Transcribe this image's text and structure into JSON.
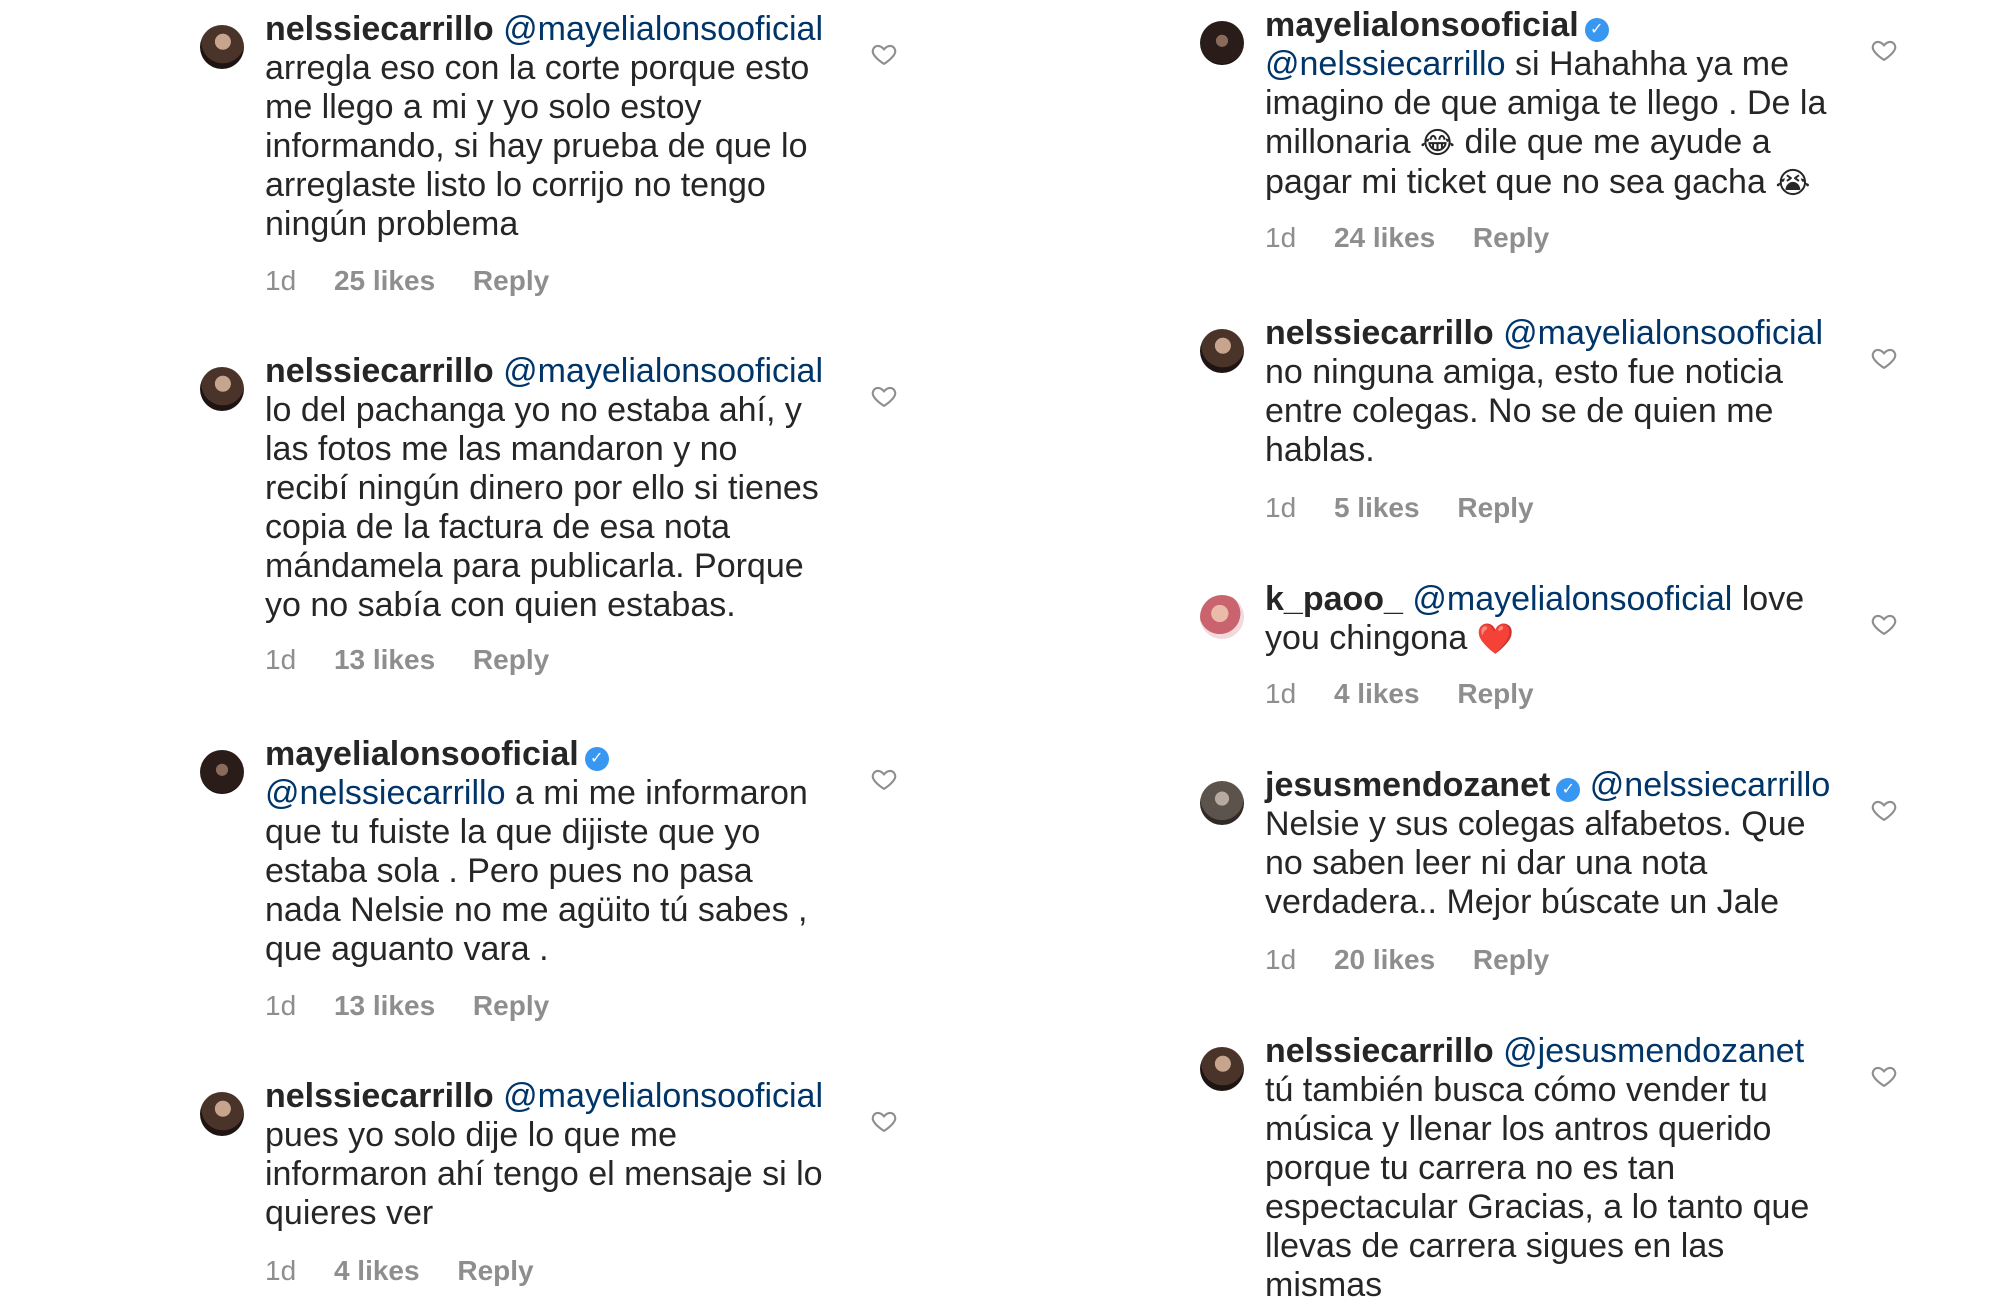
{
  "left_column": [
    {
      "username": "nelssiecarrillo",
      "verified": false,
      "mention": "@mayelialonsooficial",
      "text": "arregla eso con la corte porque esto me llego a mi y yo solo estoy informando, si hay prueba de que lo arreglaste listo lo corrijo no tengo ningún problema",
      "time": "1d",
      "likes": "25 likes",
      "reply": "Reply"
    },
    {
      "username": "nelssiecarrillo",
      "verified": false,
      "mention": "@mayelialonsooficial",
      "text": "lo del pachanga yo no estaba ahí, y las fotos me las mandaron y no recibí ningún dinero por ello si tienes copia de la factura de esa nota mándamela para publicarla. Porque yo no sabía con quien estabas.",
      "time": "1d",
      "likes": "13 likes",
      "reply": "Reply"
    },
    {
      "username": "mayelialonsooficial",
      "verified": true,
      "mention": "@nelssiecarrillo",
      "text": "a mi me informaron que tu fuiste la que dijiste que yo estaba sola . Pero pues no pasa nada Nelsie no me agüito tú sabes , que aguanto vara .",
      "time": "1d",
      "likes": "13 likes",
      "reply": "Reply"
    },
    {
      "username": "nelssiecarrillo",
      "verified": false,
      "mention": "@mayelialonsooficial",
      "text": "pues yo solo dije lo que me informaron ahí tengo el mensaje si lo quieres ver",
      "time": "1d",
      "likes": "4 likes",
      "reply": "Reply"
    }
  ],
  "right_column": [
    {
      "username": "mayelialonsooficial",
      "verified": true,
      "mention": "@nelssiecarrillo",
      "text_before_emoji_1": "si Hahahha ya me imagino de que amiga te llego . De la millonaria",
      "emoji_1": "😂",
      "text_after_emoji_1": "dile que me ayude a pagar mi ticket que no sea gacha",
      "emoji_2": "😭",
      "time": "1d",
      "likes": "24 likes",
      "reply": "Reply"
    },
    {
      "username": "nelssiecarrillo",
      "verified": false,
      "mention": "@mayelialonsooficial",
      "text": "no ninguna amiga, esto fue noticia entre colegas. No se de quien me hablas.",
      "time": "1d",
      "likes": "5 likes",
      "reply": "Reply"
    },
    {
      "username": "k_paoo_",
      "verified": false,
      "mention": "@mayelialonsooficial",
      "text": "love you chingona",
      "emoji": "❤️",
      "time": "1d",
      "likes": "4 likes",
      "reply": "Reply"
    },
    {
      "username": "jesusmendozanet",
      "verified": true,
      "mention": "@nelssiecarrillo",
      "text": "Nelsie y sus colegas alfabetos. Que no saben leer ni dar una nota verdadera.. Mejor búscate un Jale",
      "time": "1d",
      "likes": "20 likes",
      "reply": "Reply"
    },
    {
      "username": "nelssiecarrillo",
      "verified": false,
      "mention": "@jesusmendozanet",
      "text": "tú también busca cómo vender tu música y llenar los antros querido porque tu carrera no es tan espectacular Gracias, a lo tanto que llevas de carrera sigues en las mismas"
    }
  ],
  "icons": {
    "heart": "heart-outline-icon",
    "verified": "verified-badge-icon"
  },
  "colors": {
    "text": "#262626",
    "mention": "#003569",
    "meta": "#8e8e8e",
    "verified": "#3897f0"
  }
}
